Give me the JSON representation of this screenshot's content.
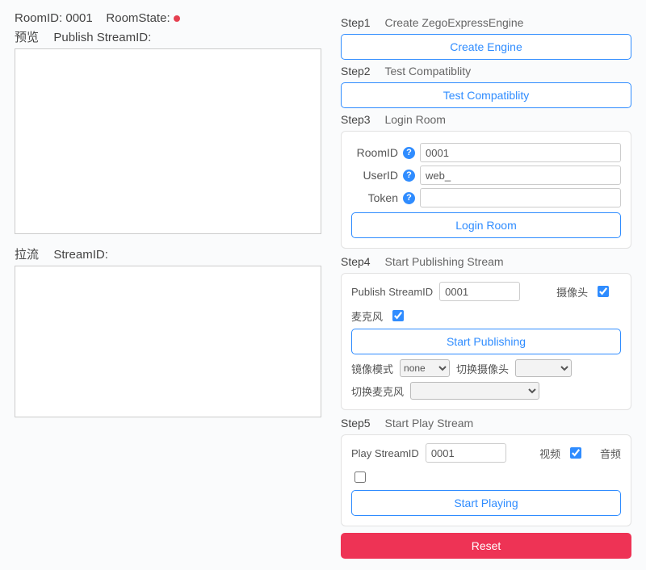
{
  "header": {
    "roomid_label": "RoomID:",
    "roomid_value": "0001",
    "roomstate_label": "RoomState:",
    "roomstate_color": "#e54050"
  },
  "left": {
    "preview_label": "预览",
    "publish_streamid_label": "Publish StreamID:",
    "play_label": "拉流",
    "play_streamid_label": "StreamID:"
  },
  "step1": {
    "num": "Step1",
    "desc": "Create ZegoExpressEngine",
    "btn": "Create Engine"
  },
  "step2": {
    "num": "Step2",
    "desc": "Test Compatiblity",
    "btn": "Test Compatiblity"
  },
  "step3": {
    "num": "Step3",
    "desc": "Login Room",
    "roomid_label": "RoomID",
    "roomid_value": "0001",
    "userid_label": "UserID",
    "userid_value": "web_",
    "token_label": "Token",
    "token_value": "",
    "btn": "Login Room"
  },
  "step4": {
    "num": "Step4",
    "desc": "Start Publishing Stream",
    "publish_label": "Publish StreamID",
    "publish_value": "0001",
    "camera_label": "摄像头",
    "camera_checked": true,
    "mic_label": "麦克风",
    "mic_checked": true,
    "btn": "Start Publishing",
    "mirror_label": "镜像模式",
    "mirror_value": "none",
    "switch_camera_label": "切换摄像头",
    "switch_camera_value": "",
    "switch_mic_label": "切换麦克风",
    "switch_mic_value": ""
  },
  "step5": {
    "num": "Step5",
    "desc": "Start Play Stream",
    "play_label": "Play StreamID",
    "play_value": "0001",
    "video_label": "视频",
    "video_checked": true,
    "audio_label": "音频",
    "audio_checked": false,
    "btn": "Start Playing"
  },
  "reset_btn": "Reset"
}
